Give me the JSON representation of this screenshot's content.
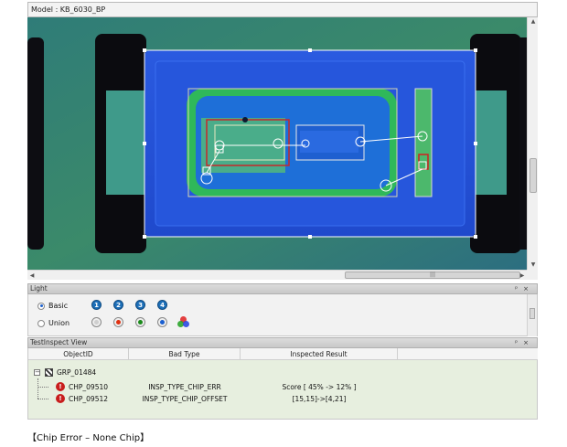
{
  "model": {
    "title": "Model : KB_6030_BP"
  },
  "light": {
    "title": "Light",
    "modes": [
      {
        "label": "Basic",
        "selected": true
      },
      {
        "label": "Union",
        "selected": false
      }
    ],
    "channels": [
      "1",
      "2",
      "3",
      "4"
    ],
    "led_colors": [
      "#cfcfcf",
      "#e03010",
      "#1a8a1a",
      "#1a5fd0"
    ]
  },
  "test_inspect": {
    "title": "TestInspect View",
    "columns": [
      "ObjectID",
      "Bad Type",
      "Inspected Result"
    ],
    "group": "GRP_01484",
    "rows": [
      {
        "object_id": "CHP_09510",
        "bad_type": "INSP_TYPE_CHIP_ERR",
        "result": "Score [ 45% -> 12% ]"
      },
      {
        "object_id": "CHP_09512",
        "bad_type": "INSP_TYPE_CHIP_OFFSET",
        "result": "[15,15]->[4,21]"
      }
    ]
  },
  "caption": "【Chip Error – None Chip】",
  "colors": {
    "error": "#c81d1d",
    "badge": "#1d6fb8",
    "row_bg": "#e7efdf"
  }
}
